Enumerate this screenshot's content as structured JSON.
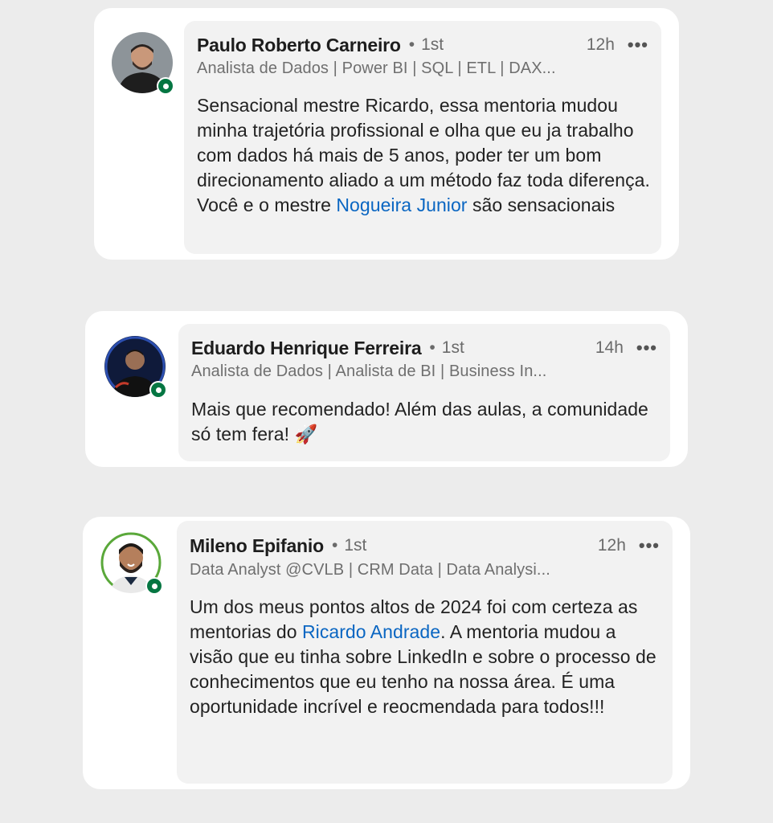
{
  "comments": [
    {
      "author": "Paulo Roberto Carneiro",
      "degree": "1st",
      "time": "12h",
      "headline": "Analista de Dados | Power BI | SQL | ETL | DAX...",
      "text_before": "Sensacional mestre Ricardo, essa mentoria mudou minha trajetória profissional e olha que eu ja trabalho com dados há mais de 5 anos, poder ter um bom direcionamento aliado a um método faz toda diferença. Você e o mestre ",
      "mention": "Nogueira Junior",
      "text_after": " são sensacionais"
    },
    {
      "author": "Eduardo Henrique Ferreira",
      "degree": "1st",
      "time": "14h",
      "headline": "Analista de Dados | Analista de BI | Business In...",
      "text_before": "Mais que recomendado! Além das aulas, a comunidade só tem fera! 🚀",
      "mention": "",
      "text_after": ""
    },
    {
      "author": "Mileno Epifanio",
      "degree": "1st",
      "time": "12h",
      "headline": "Data Analyst @CVLB | CRM Data | Data Analysi...",
      "text_before": "Um dos meus pontos altos de 2024 foi com certeza as mentorias do ",
      "mention": "Ricardo Andrade",
      "text_after": ". A mentoria mudou a visão que eu tinha sobre LinkedIn e sobre o processo de conhecimentos que eu tenho na nossa área. É uma oportunidade incrível e reocmendada para todos!!!"
    }
  ],
  "ui": {
    "separator_dot": "•",
    "more_icon": "•••"
  },
  "colors": {
    "mention": "#0a66c2",
    "presence": "#057642",
    "page_bg": "#ececec",
    "bubble_bg": "#f2f2f2"
  }
}
